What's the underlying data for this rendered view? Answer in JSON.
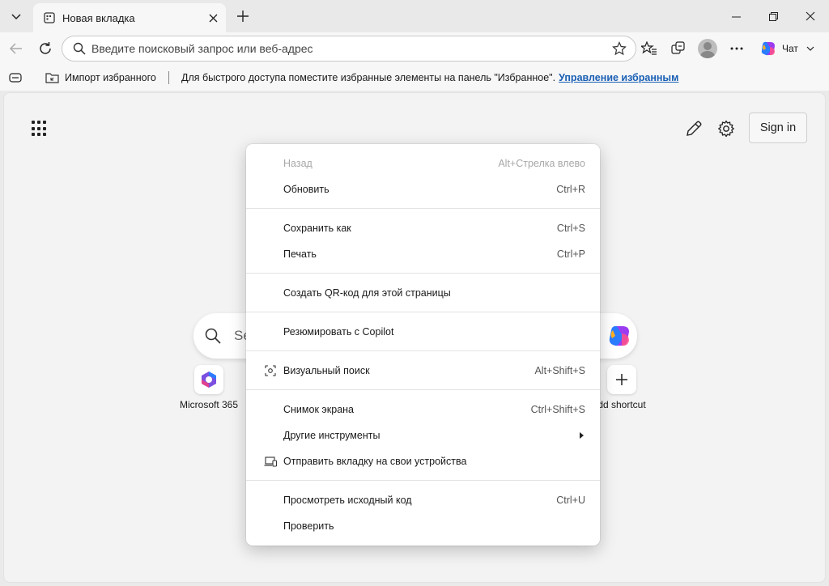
{
  "tab": {
    "title": "Новая вкладка"
  },
  "address": {
    "placeholder": "Введите поисковый запрос или веб-адрес"
  },
  "toolbar": {
    "chat_label": "Чат"
  },
  "favorites_bar": {
    "import_label": "Импорт избранного",
    "hint_text": "Для быстрого доступа поместите избранные элементы на панель \"Избранное\".",
    "manage_link": "Управление избранным"
  },
  "page": {
    "sign_in": "Sign in",
    "search_text": "Se",
    "shortcuts": [
      {
        "label": "Microsoft 365"
      },
      {
        "label": "dd shortcut"
      }
    ]
  },
  "context_menu": {
    "items": [
      {
        "label": "Назад",
        "shortcut": "Alt+Стрелка влево",
        "disabled": true
      },
      {
        "label": "Обновить",
        "shortcut": "Ctrl+R"
      },
      {
        "label": "Сохранить как",
        "shortcut": "Ctrl+S"
      },
      {
        "label": "Печать",
        "shortcut": "Ctrl+P"
      },
      {
        "label": "Создать QR-код для этой страницы",
        "shortcut": ""
      },
      {
        "label": "Резюмировать с Copilot",
        "shortcut": ""
      },
      {
        "label": "Визуальный поиск",
        "shortcut": "Alt+Shift+S",
        "icon": "visual-search-icon"
      },
      {
        "label": "Снимок экрана",
        "shortcut": "Ctrl+Shift+S"
      },
      {
        "label": "Другие инструменты",
        "shortcut": "",
        "submenu": true
      },
      {
        "label": "Отправить вкладку на свои устройства",
        "shortcut": "",
        "icon": "devices-icon"
      },
      {
        "label": "Просмотреть исходный код",
        "shortcut": "Ctrl+U"
      },
      {
        "label": "Проверить",
        "shortcut": ""
      }
    ]
  },
  "colors": {
    "link": "#1a5fb4",
    "disabled_text": "#a8a8a8",
    "copilot_gradient": [
      "#2b7cff",
      "#9b3cf0",
      "#ff4f8b",
      "#ffb020"
    ]
  }
}
